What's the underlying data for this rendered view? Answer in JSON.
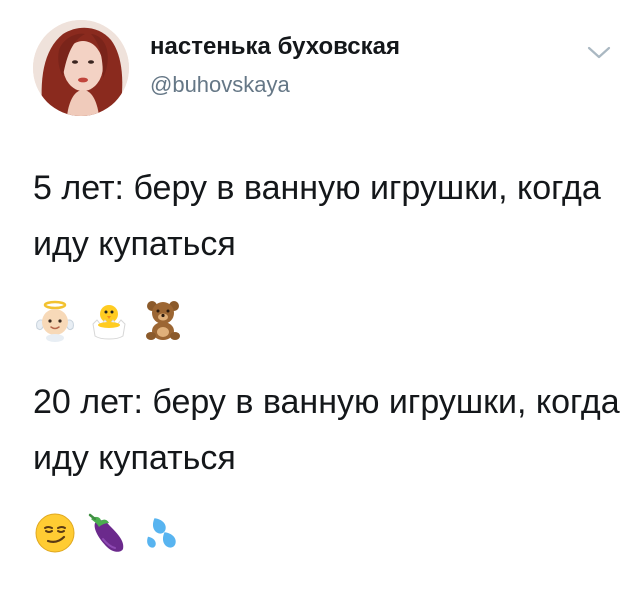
{
  "tweet": {
    "display_name": "настенька буховская",
    "handle": "@buhovskaya",
    "line1_text": "5 лет: беру в ванную игрушки, когда иду купаться",
    "line1_emojis": [
      "baby-angel-icon",
      "hatching-chick-icon",
      "teddy-bear-icon"
    ],
    "line2_text": "20 лет: беру в ванную игрушки, когда иду купаться",
    "line2_emojis": [
      "smirking-face-icon",
      "eggplant-icon",
      "sweat-droplets-icon"
    ]
  },
  "colors": {
    "text": "#14171a",
    "handle": "#657786",
    "chevron": "#aab8c2",
    "background": "#ffffff"
  }
}
